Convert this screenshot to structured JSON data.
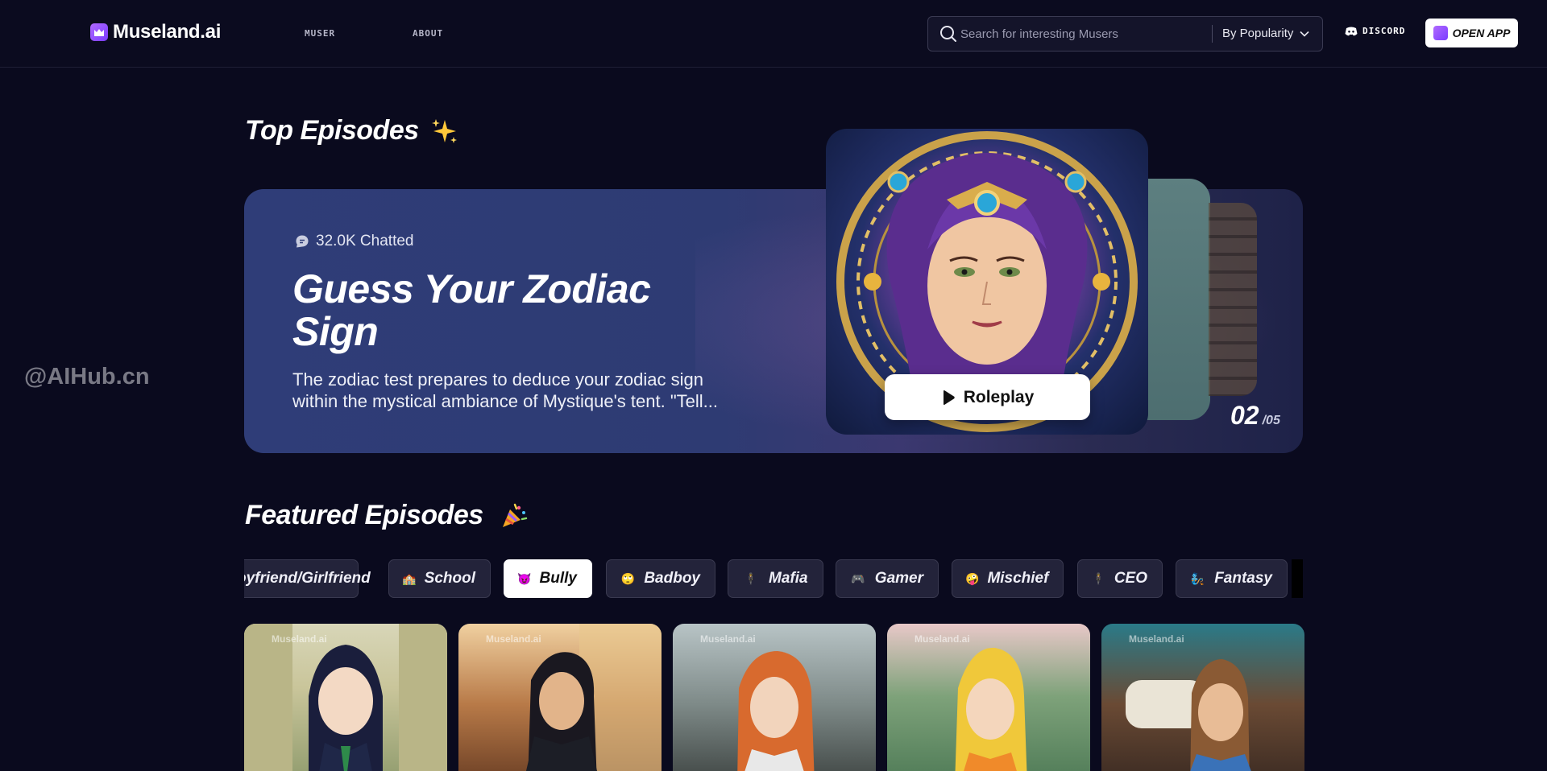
{
  "header": {
    "logo_text": "Museland.ai",
    "nav": [
      {
        "label": "MUSER"
      },
      {
        "label": "ABOUT"
      }
    ],
    "search_placeholder": "Search for interesting Musers",
    "sort_label": "By Popularity",
    "discord_label": "DISCORD",
    "open_app_label": "OPEN APP"
  },
  "top_episodes": {
    "title": "Top Episodes",
    "title_icon": "sparkles-icon",
    "featured": {
      "chatted": "32.0K Chatted",
      "title": "Guess Your Zodiac Sign",
      "description": "The zodiac test prepares to deduce your zodiac sign within the mystical ambiance of Mystique's tent. \"Tell...",
      "button_label": "Roleplay",
      "page_current": "02",
      "page_total": "/05"
    }
  },
  "featured_episodes": {
    "title": "Featured Episodes",
    "title_icon": "party-popper-icon",
    "tags": [
      {
        "label": "Boyfriend/Girlfriend",
        "visible_label": "oyfriend/Girlfriend",
        "emoji": ""
      },
      {
        "label": "School",
        "emoji": "🏫"
      },
      {
        "label": "Bully",
        "emoji": "😈",
        "active": true
      },
      {
        "label": "Badboy",
        "emoji": "🙄"
      },
      {
        "label": "Mafia",
        "emoji": "🕴"
      },
      {
        "label": "Gamer",
        "emoji": "🎮"
      },
      {
        "label": "Mischief",
        "emoji": "🤪"
      },
      {
        "label": "CEO",
        "emoji": "🕴"
      },
      {
        "label": "Fantasy",
        "emoji": "🧞"
      }
    ],
    "cards_watermark": "Museland.ai"
  },
  "watermark": "@AIHub.cn",
  "colors": {
    "background": "#0a0a1e",
    "accent": "#9b5cff",
    "hero": "#2f3d78"
  }
}
